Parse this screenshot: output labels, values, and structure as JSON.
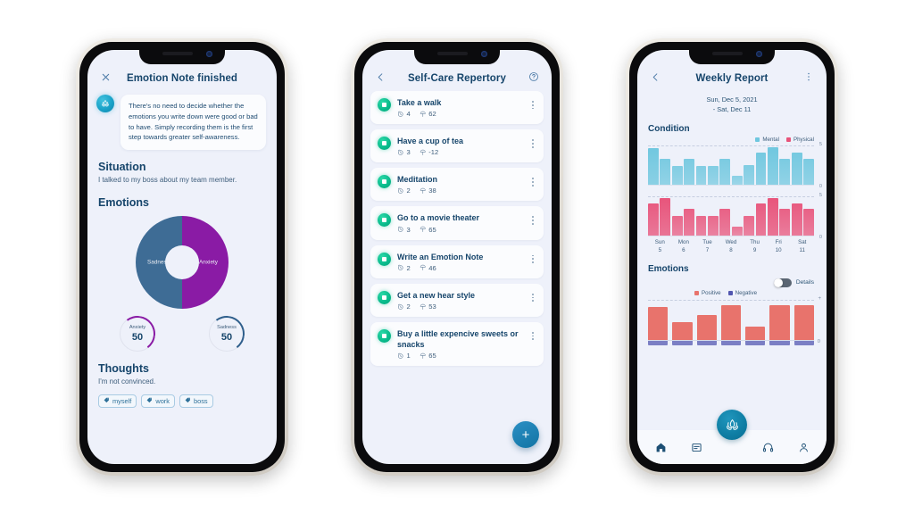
{
  "phone1": {
    "appbar": {
      "title": "Emotion Note finished",
      "close_icon": "close-icon"
    },
    "tip": {
      "text": "There's no need to decide whether the emotions you write down were good or bad to have. Simply recording them is the first step towards greater self-awareness."
    },
    "situation": {
      "heading": "Situation",
      "text": "I talked to my boss about my team member."
    },
    "emotions": {
      "heading": "Emotions"
    },
    "thoughts": {
      "heading": "Thoughts",
      "text": "I'm not convinced."
    },
    "tags": [
      "myself",
      "work",
      "boss"
    ],
    "gauges": [
      {
        "label": "Anxiety",
        "value": "50",
        "color": "#8a1ba5"
      },
      {
        "label": "Sadness",
        "value": "50",
        "color": "#2f5f8c"
      }
    ],
    "chart_data": {
      "type": "pie",
      "title": "Emotions",
      "categories": [
        "Anxiety",
        "Sadness"
      ],
      "values": [
        50,
        50
      ],
      "colors": [
        "#8a1ba5",
        "#3e6c95"
      ],
      "legend": "in-slice labels"
    }
  },
  "phone2": {
    "appbar": {
      "title": "Self-Care Repertory",
      "back_icon": "chevron-left-icon",
      "help_icon": "help-circle-icon"
    },
    "fab_label": "+",
    "items": [
      {
        "name": "Take a walk",
        "time": "4",
        "score": "62"
      },
      {
        "name": "Have a cup of tea",
        "time": "3",
        "score": "-12"
      },
      {
        "name": "Meditation",
        "time": "2",
        "score": "38"
      },
      {
        "name": "Go to a movie theater",
        "time": "3",
        "score": "65"
      },
      {
        "name": "Write an Emotion Note",
        "time": "2",
        "score": "46"
      },
      {
        "name": "Get a new hear style",
        "time": "2",
        "score": "53"
      },
      {
        "name": "Buy a little expencive sweets or snacks",
        "time": "1",
        "score": "65"
      }
    ]
  },
  "phone3": {
    "appbar": {
      "title": "Weekly Report",
      "back_icon": "chevron-left-icon",
      "menu_icon": "more-vertical-icon"
    },
    "daterange": "Sun, Dec 5, 2021\n- Sat, Dec 11",
    "condition": {
      "heading": "Condition",
      "legend": [
        {
          "label": "Mental",
          "color": "#6fc7df"
        },
        {
          "label": "Physical",
          "color": "#e8537a"
        }
      ],
      "axis_max": "5",
      "axis_min": "0"
    },
    "days": [
      {
        "name": "Sun",
        "num": "5"
      },
      {
        "name": "Mon",
        "num": "6"
      },
      {
        "name": "Tue",
        "num": "7"
      },
      {
        "name": "Wed",
        "num": "8"
      },
      {
        "name": "Thu",
        "num": "9"
      },
      {
        "name": "Fri",
        "num": "10"
      },
      {
        "name": "Sat",
        "num": "11"
      }
    ],
    "emotions": {
      "heading": "Emotions",
      "details_label": "Details",
      "details_on": false,
      "legend": [
        {
          "label": "Positive",
          "color": "#e8736c"
        },
        {
          "label": "Negative",
          "color": "#5257b0"
        }
      ],
      "axis_plus": "+",
      "axis_zero": "0"
    },
    "nav": [
      "home-icon",
      "notes-icon",
      "lotus-fab-icon",
      "headphones-icon",
      "profile-icon"
    ],
    "chart_data": [
      {
        "type": "bar",
        "title": "Condition - Mental",
        "categories": [
          "Sun 5",
          "Sun 5",
          "Mon 6",
          "Mon 6",
          "Tue 7",
          "Tue 7",
          "Wed 8",
          "Wed 8",
          "Thu 9",
          "Thu 9",
          "Fri 10",
          "Fri 10",
          "Sat 11",
          "Sat 11"
        ],
        "values": [
          4.7,
          3.3,
          2.4,
          3.3,
          2.4,
          2.4,
          3.3,
          1.2,
          2.5,
          4.1,
          4.8,
          3.3,
          4.1,
          3.3
        ],
        "ylim": [
          0,
          5
        ],
        "ylabel": "",
        "xlabel": "",
        "color": "#6fc7df",
        "grid": true
      },
      {
        "type": "bar",
        "title": "Condition - Physical",
        "categories": [
          "Sun 5",
          "Sun 5",
          "Mon 6",
          "Mon 6",
          "Tue 7",
          "Tue 7",
          "Wed 8",
          "Wed 8",
          "Thu 9",
          "Thu 9",
          "Fri 10",
          "Fri 10",
          "Sat 11",
          "Sat 11"
        ],
        "values": [
          4.1,
          4.8,
          2.5,
          3.4,
          2.5,
          2.5,
          3.4,
          1.2,
          2.5,
          4.1,
          4.8,
          3.4,
          4.1,
          3.4
        ],
        "ylim": [
          0,
          5
        ],
        "ylabel": "",
        "xlabel": "",
        "color": "#e8537a",
        "grid": true
      },
      {
        "type": "bar",
        "title": "Emotions",
        "categories": [
          "Sun 5",
          "Mon 6",
          "Tue 7",
          "Wed 8",
          "Thu 9",
          "Fri 10",
          "Sat 11"
        ],
        "series": [
          {
            "name": "Positive",
            "values": [
              0.82,
              0.45,
              0.62,
              0.85,
              0.33,
              0.85,
              0.85
            ],
            "color": "#e8736c"
          },
          {
            "name": "Negative",
            "values": [
              -0.12,
              -0.12,
              -0.12,
              -0.12,
              -0.12,
              -0.12,
              -0.12
            ],
            "color": "#7b7fc4"
          }
        ],
        "ylim": [
          -0.2,
          1.0
        ],
        "grid": true,
        "legend": "top-center"
      }
    ]
  }
}
